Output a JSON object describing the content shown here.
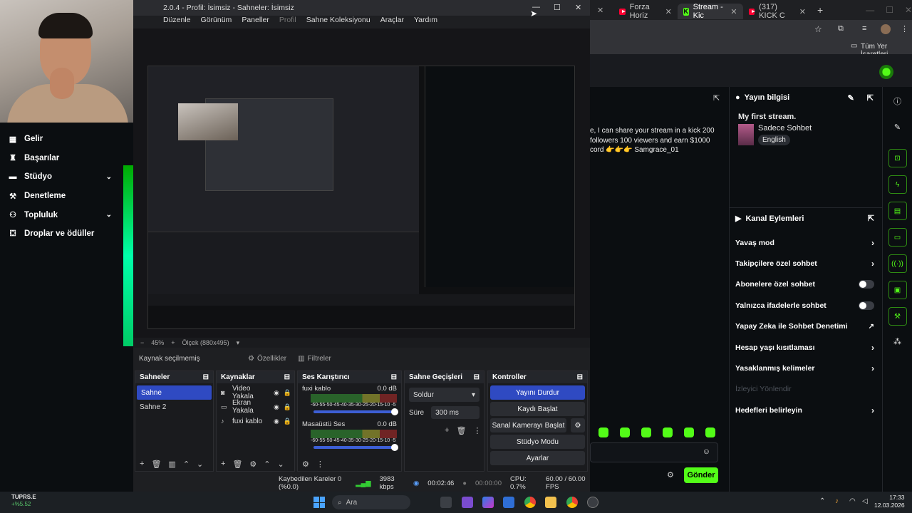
{
  "browser": {
    "tabs": [
      {
        "label": "Forza Horiz",
        "icon": "youtube-icon"
      },
      {
        "label": "Stream - Kic",
        "icon": "kick-icon",
        "active": true
      },
      {
        "label": "(317) KICK C",
        "icon": "youtube-icon"
      }
    ],
    "new_tab": "+",
    "bookmarks_label": "Tüm Yer İşaretleri"
  },
  "chat": {
    "message": "e, I can share your stream in a kick 200 followers 100 viewers and earn $1000 cord 👉👉👉 Samgrace_01",
    "input_placeholder": "",
    "send_label": "Gönder"
  },
  "stream_info": {
    "header": "Yayın bilgisi",
    "title": "My first stream.",
    "category": "Sadece Sohbet",
    "language": "English"
  },
  "channel_actions": {
    "header": "Kanal Eylemleri",
    "items": [
      {
        "label": "Yavaş mod",
        "control": "chevron"
      },
      {
        "label": "Takipçilere özel sohbet",
        "control": "chevron"
      },
      {
        "label": "Abonelere özel sohbet",
        "control": "toggle"
      },
      {
        "label": "Yalnızca ifadelerle sohbet",
        "control": "toggle"
      },
      {
        "label": "Yapay Zeka ile Sohbet Denetimi",
        "control": "external"
      },
      {
        "label": "Hesap yaşı kısıtlaması",
        "control": "chevron"
      },
      {
        "label": "Yasaklanmış kelimeler",
        "control": "chevron"
      },
      {
        "label": "İzleyici Yönlendir",
        "control": "none",
        "disabled": true
      },
      {
        "label": "Hedefleri belirleyin",
        "control": "chevron"
      }
    ]
  },
  "sidebar": {
    "items": [
      {
        "label": "Gelir",
        "icon": "revenue-icon"
      },
      {
        "label": "Başarılar",
        "icon": "trophy-icon"
      },
      {
        "label": "Stüdyo",
        "icon": "studio-icon",
        "expandable": true
      },
      {
        "label": "Denetleme",
        "icon": "wrench-icon"
      },
      {
        "label": "Topluluk",
        "icon": "community-icon",
        "expandable": true
      },
      {
        "label": "Droplar ve ödüller",
        "icon": "gift-icon"
      }
    ]
  },
  "obs": {
    "title": "2.0.4 - Profil: İsimsiz - Sahneler: İsimsiz",
    "menu": [
      "Düzenle",
      "Görünüm",
      "Paneller",
      "Profil",
      "Sahne Koleksiyonu",
      "Araçlar",
      "Yardım"
    ],
    "preview_zoom": "45%",
    "preview_scale": "Ölçek (880x495)",
    "no_source": "Kaynak seçilmemiş",
    "properties": "Özellikler",
    "filters": "Filtreler",
    "scenes": {
      "header": "Sahneler",
      "items": [
        "Sahne",
        "Sahne 2"
      ]
    },
    "sources": {
      "header": "Kaynaklar",
      "items": [
        {
          "name": "Video Yakala",
          "icon": "camera-icon"
        },
        {
          "name": "Ekran Yakala",
          "icon": "monitor-icon"
        },
        {
          "name": "fuxi kablo",
          "icon": "microphone-icon"
        }
      ]
    },
    "mixer": {
      "header": "Ses Karıştırıcı",
      "channels": [
        {
          "name": "fuxi kablo",
          "db": "0.0 dB",
          "scale": "-60-55-50-45-40-35-30-25-20-15-10 -5 0"
        },
        {
          "name": "Masaüstü Ses",
          "db": "0.0 dB",
          "scale": "-60-55-50-45-40-35-30-25-20-15-10 -5 0"
        }
      ]
    },
    "transitions": {
      "header": "Sahne Geçişleri",
      "selected": "Soldur",
      "duration_label": "Süre",
      "duration": "300 ms"
    },
    "controls": {
      "header": "Kontroller",
      "stop_stream": "Yayını Durdur",
      "start_record": "Kaydı Başlat",
      "virtual_cam": "Sanal Kamerayı Başlat",
      "studio_mode": "Stüdyo Modu",
      "settings": "Ayarlar"
    },
    "status": {
      "dropped": "Kaybedilen Kareler 0 (%0.0)",
      "bitrate": "3983 kbps",
      "stream_time": "00:02:46",
      "rec_time": "00:00:00",
      "cpu": "CPU: 0.7%",
      "fps": "60.00 / 60.00 FPS"
    }
  },
  "taskbar": {
    "stock_name": "TUPRS.E",
    "stock_change": "+%5.52",
    "search": "Ara",
    "time": "17:33",
    "date": "12.03.2026"
  }
}
